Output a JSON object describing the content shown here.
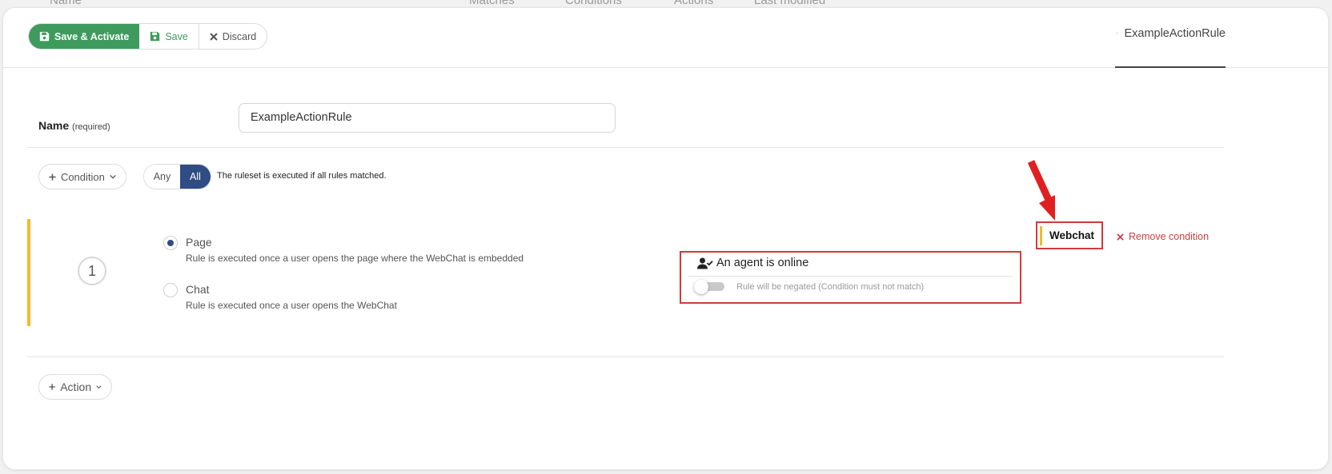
{
  "background_header": {
    "col1": "Name",
    "col2": "Matches",
    "col3": "Conditions",
    "col4": "Actions",
    "col5": "Last modified"
  },
  "toolbar": {
    "save_activate_label": "Save & Activate",
    "save_label": "Save",
    "discard_label": "Discard",
    "save_color": "#3f9b5d"
  },
  "file_tab": {
    "label": "ExampleActionRule",
    "icon": "document-icon"
  },
  "name_field": {
    "label": "Name",
    "required_hint": "(required)",
    "value": "ExampleActionRule"
  },
  "condition_controls": {
    "add_condition_label": "Condition",
    "match_options": [
      "Any",
      "All"
    ],
    "selected_match": "All",
    "ruleset_text": "The ruleset is executed if all rules matched."
  },
  "condition_1": {
    "number": "1",
    "options": [
      {
        "title": "Page",
        "desc": "Rule is executed once a user opens the page where the WebChat is embedded",
        "checked": true
      },
      {
        "title": "Chat",
        "desc": "Rule is executed once a user opens the WebChat",
        "checked": false
      }
    ],
    "agent_title": "An agent is online",
    "negate_text": "Rule will be negated (Condition must not match)",
    "negate_on": false,
    "category": "Webchat",
    "remove_label": "Remove condition",
    "accent_color": "#f0bb30",
    "highlight_color": "#d33a3a"
  },
  "actions": {
    "add_action_label": "Action"
  }
}
